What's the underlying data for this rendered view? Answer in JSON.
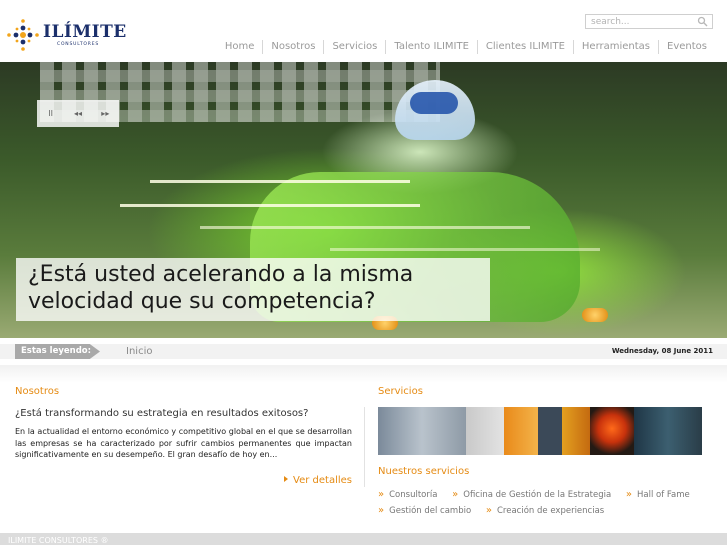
{
  "brand": {
    "name": "ILÍMITE",
    "subtitle": "CONSULTORES"
  },
  "search": {
    "placeholder": "search..."
  },
  "nav": {
    "items": [
      "Home",
      "Nosotros",
      "Servicios",
      "Talento ILIMITE",
      "Clientes ILIMITE",
      "Herramientas",
      "Eventos"
    ]
  },
  "hero": {
    "controls": {
      "pause": "II",
      "prev": "◂◂",
      "next": "▸▸"
    },
    "tagline_line1": "¿Está usted acelerando a la misma",
    "tagline_line2": "velocidad que su competencia?"
  },
  "ticker": {
    "label": "Estas leyendo:",
    "text": "Inicio",
    "date": "Wednesday, 08 June 2011"
  },
  "nosotros": {
    "title": "Nosotros",
    "question": "¿Está transformando su estrategia en resultados exitosos?",
    "body": "En la actualidad el entorno económico y competitivo global en el que se desarrollan las empresas se ha caracterizado por sufrir cambios permanentes que impactan significativamente en su desempeño. El gran desafío de hoy en...",
    "more": "Ver detalles"
  },
  "servicios": {
    "title": "Servicios",
    "subtitle": "Nuestros servicios",
    "items": [
      "Consultoría",
      "Oficina de Gestión de la Estrategia",
      "Hall of Fame",
      "Gestión del cambio",
      "Creación de experiencias"
    ]
  },
  "footer": {
    "text": "ILIMITE CONSULTORES ®"
  },
  "colors": {
    "accent": "#e58b14",
    "brand": "#1b2f6b"
  }
}
